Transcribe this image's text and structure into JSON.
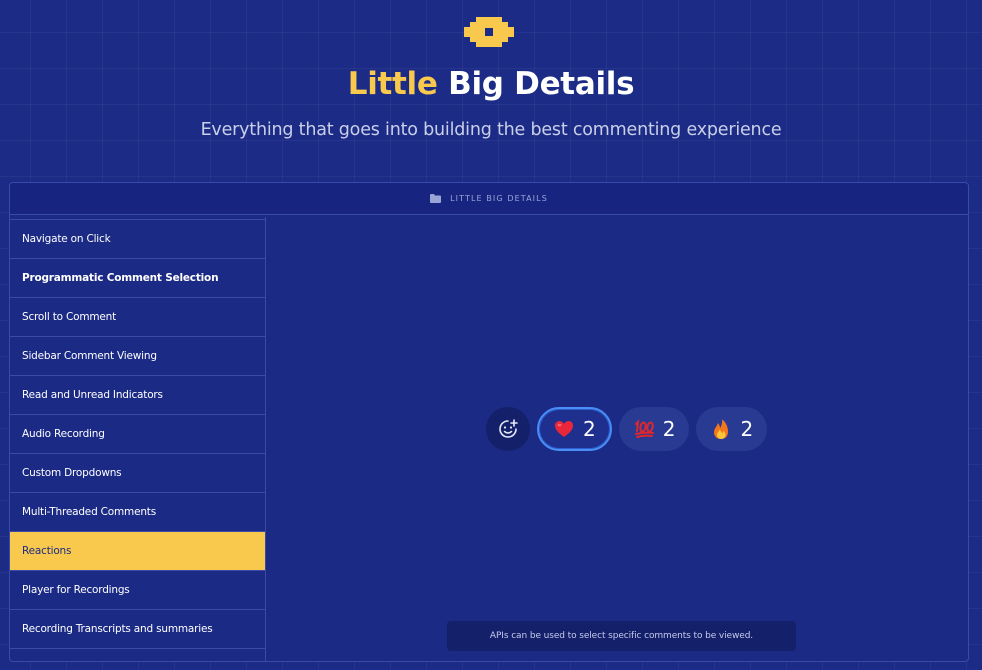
{
  "hero": {
    "title_accent": "Little",
    "title_rest": "Big Details",
    "subtitle": "Everything that goes into building the best commenting experience"
  },
  "panel": {
    "header_label": "LITTLE BIG DETAILS",
    "header_icon": "folder-icon"
  },
  "sidebar": {
    "items": [
      {
        "label": "Navigate on Click"
      },
      {
        "label": "Programmatic Comment Selection"
      },
      {
        "label": "Scroll to Comment"
      },
      {
        "label": "Sidebar Comment Viewing"
      },
      {
        "label": "Read and Unread Indicators"
      },
      {
        "label": "Audio Recording"
      },
      {
        "label": "Custom Dropdowns"
      },
      {
        "label": "Multi-Threaded Comments"
      },
      {
        "label": "Reactions"
      },
      {
        "label": "Player for Recordings"
      },
      {
        "label": "Recording Transcripts and summaries"
      }
    ],
    "active_item": "Reactions",
    "bold_item": "Programmatic Comment Selection"
  },
  "reactions": {
    "add_icon": "add-reaction-icon",
    "items": [
      {
        "emoji": "heart",
        "count": "2",
        "selected": true
      },
      {
        "emoji": "hundred-points",
        "count": "2",
        "selected": false
      },
      {
        "emoji": "fire",
        "count": "2",
        "selected": false
      }
    ]
  },
  "tooltip": {
    "text": "APIs can be used to select specific comments to be viewed."
  },
  "colors": {
    "background": "#1c2c86",
    "accent": "#f8c94c",
    "selected_border": "#4a8ef5"
  }
}
